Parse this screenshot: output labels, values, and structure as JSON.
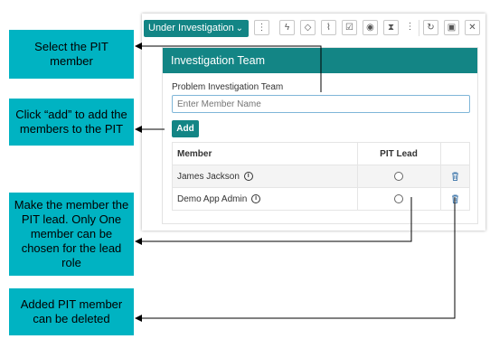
{
  "toolbar": {
    "status_label": "Under Investigation",
    "status_chevron": "⌄",
    "icons": [
      "more-vertical-icon",
      "flash-icon",
      "tag-icon",
      "attachment-icon",
      "clipboard-check-icon",
      "eye-icon",
      "hourglass-icon",
      "more-vertical-icon",
      "refresh-icon",
      "save-icon",
      "close-icon"
    ],
    "glyphs": {
      "more": "⋮",
      "flash": "ϟ",
      "tag": "◇",
      "attach": "⌇",
      "clipboard": "☑",
      "eye": "◉",
      "hourglass": "⧗",
      "refresh": "↻",
      "save": "▣",
      "close": "✕"
    }
  },
  "panel": {
    "title": "Investigation Team",
    "field_label": "Problem Investigation Team",
    "member_placeholder": "Enter Member Name",
    "add_label": "Add",
    "table": {
      "headers": [
        "Member",
        "PIT Lead"
      ],
      "rows": [
        {
          "name": "James Jackson"
        },
        {
          "name": "Demo App Admin"
        }
      ]
    }
  },
  "callouts": [
    {
      "text": "Select the PIT member"
    },
    {
      "text": "Click “add” to add the members to the PIT"
    },
    {
      "text": "Make the member the PIT lead. Only One member can be chosen for the lead role"
    },
    {
      "text": "Added PIT member can be deleted"
    }
  ],
  "colors": {
    "accent": "#138585",
    "callout": "#00b3c2",
    "input_border": "#7fb6d8"
  }
}
